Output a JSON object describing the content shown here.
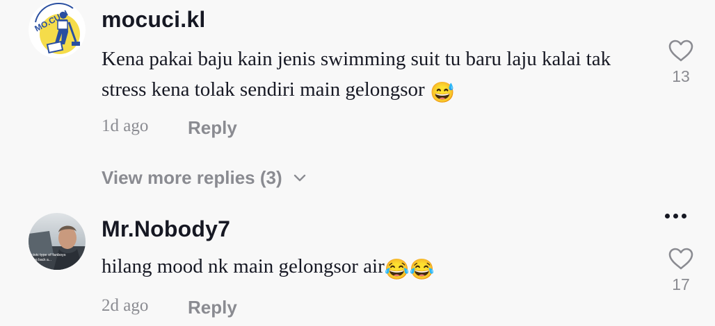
{
  "comments": [
    {
      "username": "mocuci.kl",
      "avatar_text": "MO.CUCI",
      "text": "Kena pakai baju kain jenis swimming suit tu baru laju kalai tak stress kena tolak sendiri main gelongsor",
      "emoji": "😅",
      "time": "1d ago",
      "reply_label": "Reply",
      "likes": "13",
      "view_more": "View more replies (3)"
    },
    {
      "username": "Mr.Nobody7",
      "avatar_caption": "civic type of fanboys",
      "text": "hilang mood nk main gelongsor air",
      "emoji": "😂😂",
      "time": "2d ago",
      "reply_label": "Reply",
      "likes": "17"
    }
  ],
  "icons": {
    "like": "heart-outline-icon",
    "more": "more-options-icon",
    "chevron": "chevron-down-icon"
  },
  "colors": {
    "background": "#f8f8f8",
    "primary_text": "#161823",
    "secondary_text": "#8a8b91",
    "logo_yellow": "#f5dc4a",
    "logo_blue": "#2a4fa0"
  }
}
